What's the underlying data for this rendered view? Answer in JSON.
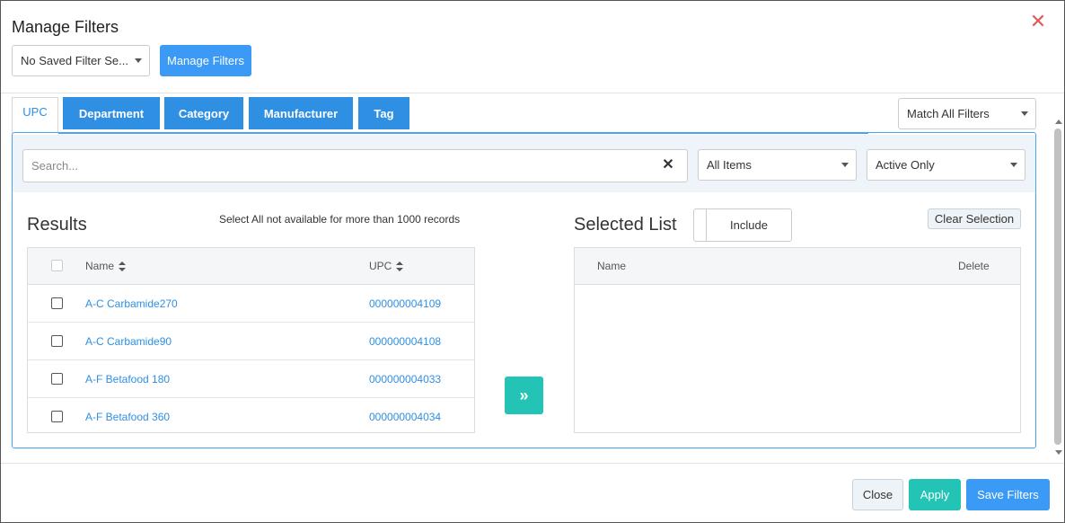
{
  "dialog": {
    "title": "Manage Filters"
  },
  "saved_filter": {
    "value": "No Saved Filter Se..."
  },
  "manage_filters_button": "Manage Filters",
  "tabs": [
    {
      "label": "UPC",
      "active": true
    },
    {
      "label": "Department",
      "active": false
    },
    {
      "label": "Category",
      "active": false
    },
    {
      "label": "Manufacturer",
      "active": false
    },
    {
      "label": "Tag",
      "active": false
    }
  ],
  "match_select": {
    "value": "Match All Filters"
  },
  "search": {
    "placeholder": "Search..."
  },
  "items_select": {
    "value": "All Items"
  },
  "status_select": {
    "value": "Active Only"
  },
  "results": {
    "heading": "Results",
    "note": "Select All not available for more than 1000 records",
    "columns": {
      "name": "Name",
      "upc": "UPC"
    },
    "rows": [
      {
        "name": "A-C Carbamide270",
        "upc": "000000004109"
      },
      {
        "name": "A-C Carbamide90",
        "upc": "000000004108"
      },
      {
        "name": "A-F Betafood 180",
        "upc": "000000004033"
      },
      {
        "name": "A-F Betafood 360",
        "upc": "000000004034"
      }
    ]
  },
  "move_button_glyph": "»",
  "selected": {
    "heading": "Selected List",
    "toggle_label": "Include",
    "clear_label": "Clear Selection",
    "columns": {
      "name": "Name",
      "delete": "Delete"
    }
  },
  "footer": {
    "close": "Close",
    "apply": "Apply",
    "save": "Save Filters"
  },
  "colors": {
    "accent": "#2f8fe3",
    "teal": "#23c4b6",
    "close_x": "#e05a5a"
  }
}
